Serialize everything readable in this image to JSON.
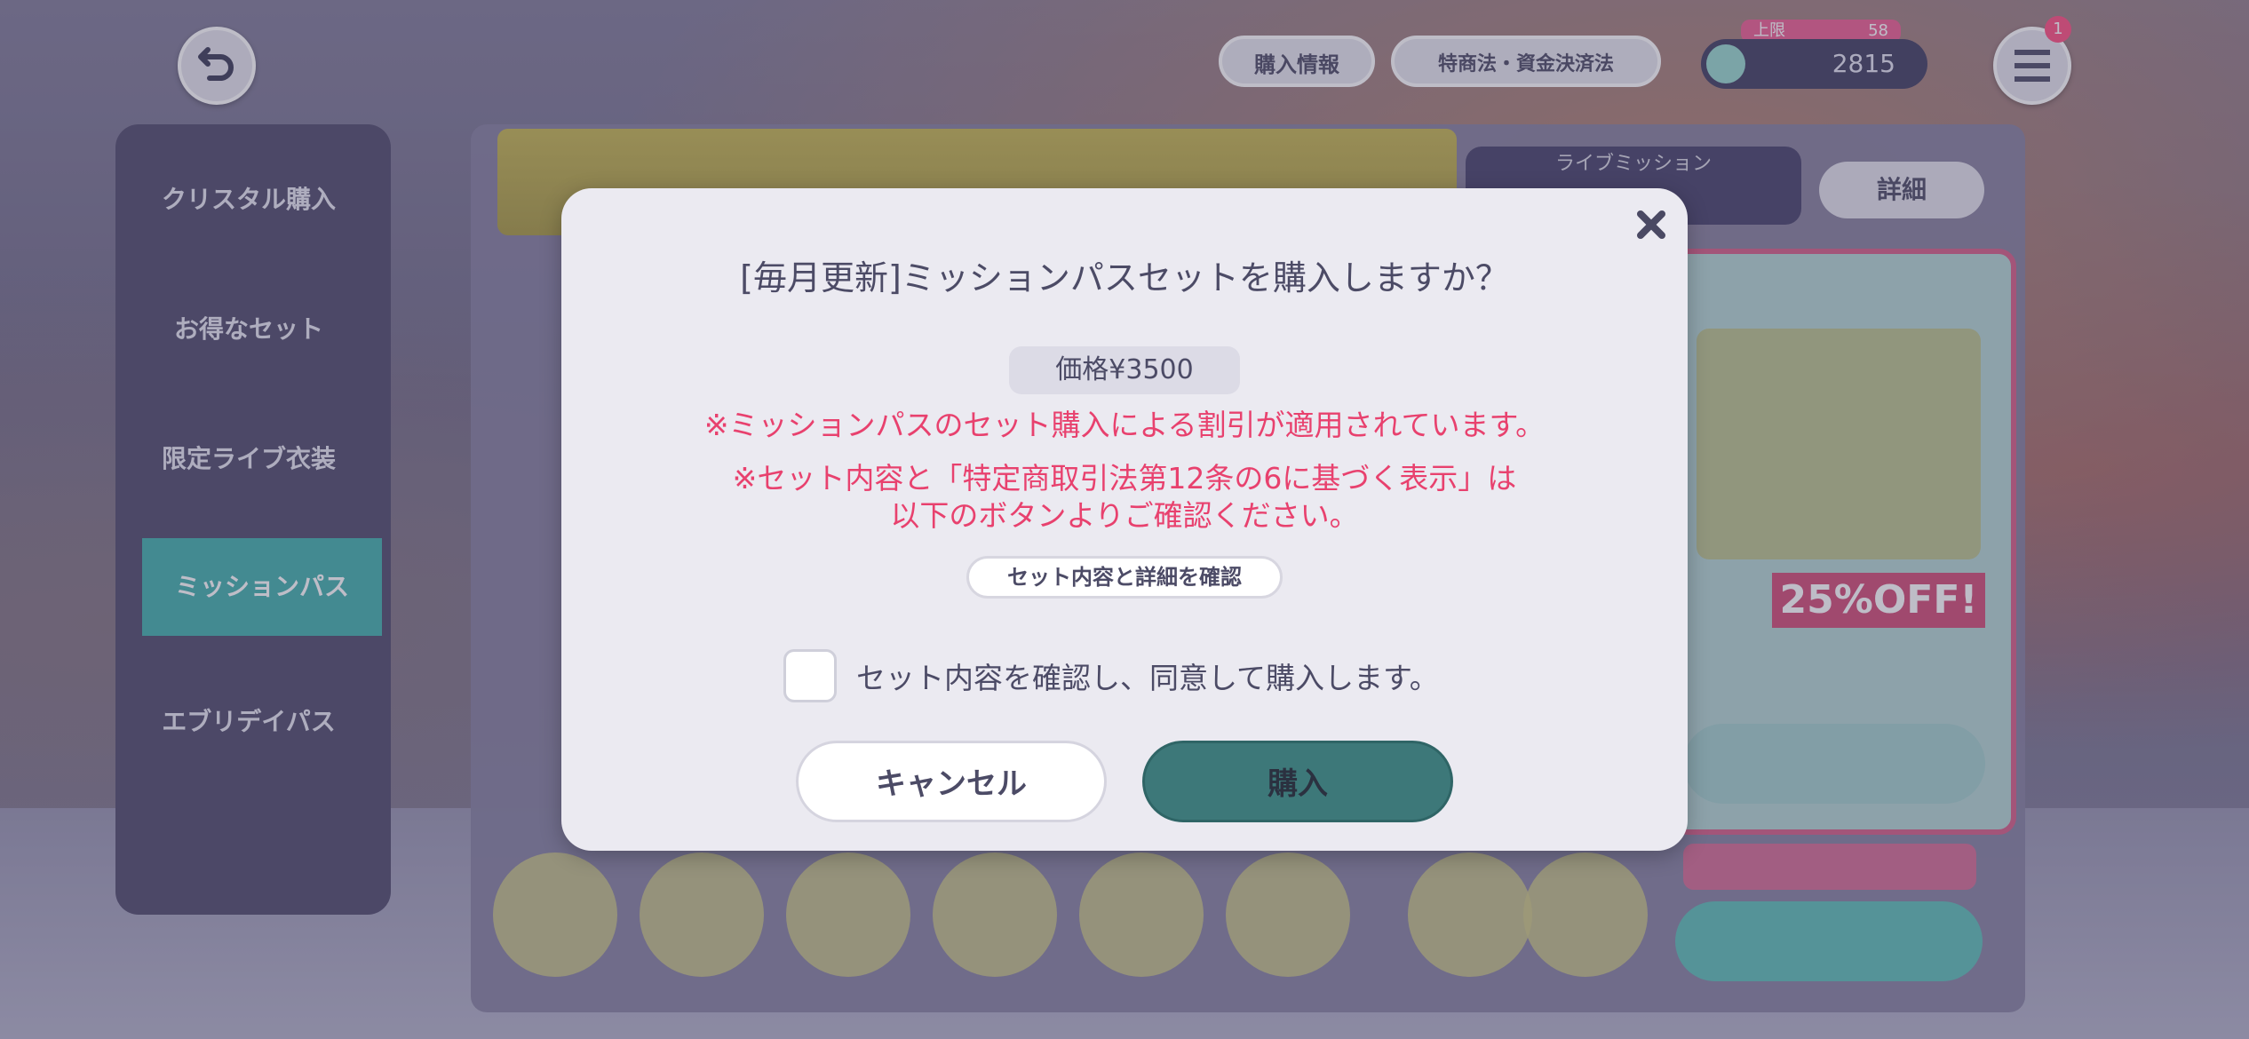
{
  "background": {
    "header": {
      "purchase_info_label": "購入情報",
      "law_label": "特商法・資金決済法",
      "crystal_gauge_label": "上限",
      "crystal_gauge_value": "58",
      "crystal_count": "2815",
      "menu_badge": "1"
    },
    "sidebar": {
      "items": [
        {
          "label": "クリスタル購入"
        },
        {
          "label": "お得なセット"
        },
        {
          "label": "限定ライブ衣装"
        },
        {
          "label": "ミッションパス"
        },
        {
          "label": "エブリデイパス"
        }
      ]
    },
    "live_mission_label": "ライブミッション",
    "detail_label": "詳細",
    "off_label": "25%OFF!",
    "colors": {
      "accent_teal": "#4fb6b2",
      "pink": "#e8416e"
    }
  },
  "modal": {
    "title": "[毎月更新]ミッションパスセットを購入しますか？",
    "price": "価格¥3500",
    "note1": "※ミッションパスのセット購入による割引が適用されています。",
    "note2_line1": "※セット内容と「特定商取引法第12条の6に基づく表示」は",
    "note2_line2": "以下のボタンよりご確認ください。",
    "detail_button": "セット内容と詳細を確認",
    "agree_text": "セット内容を確認し、同意して購入します。",
    "agree_checked": false,
    "cancel_button": "キャンセル",
    "buy_button": "購入"
  }
}
